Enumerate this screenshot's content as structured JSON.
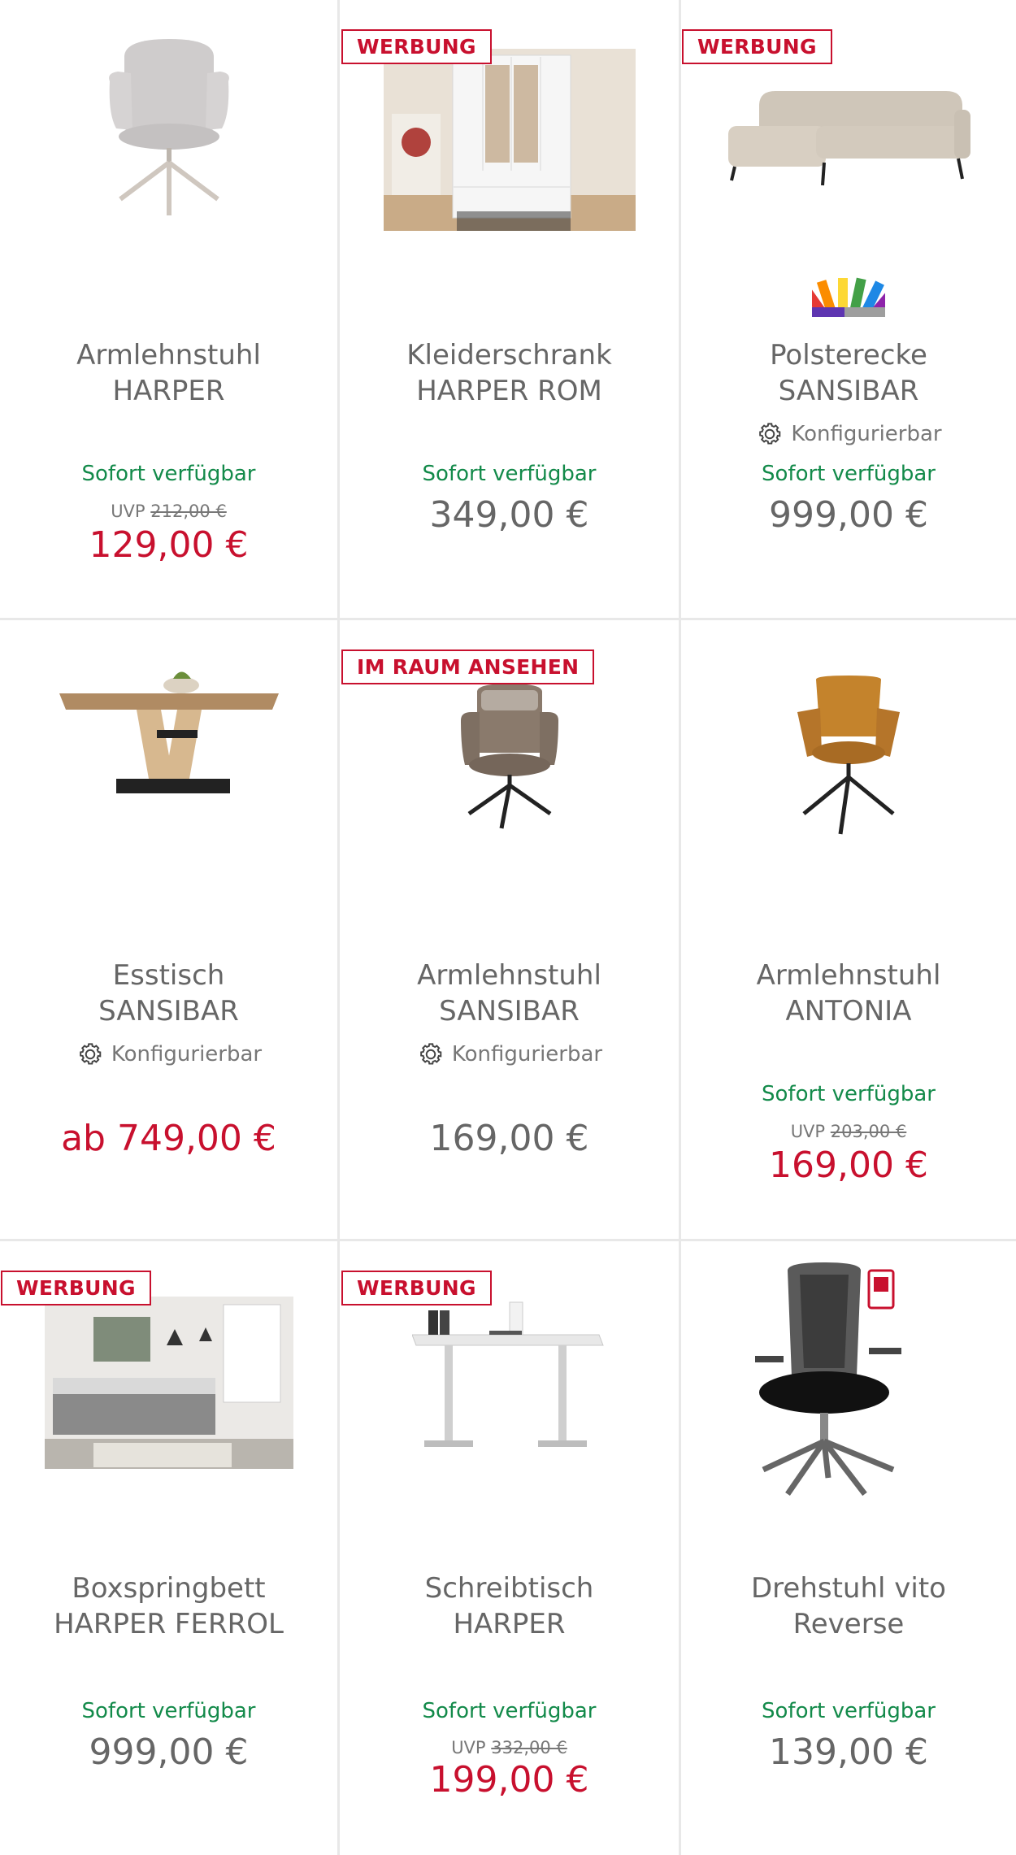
{
  "products": [
    {
      "badge": "",
      "title_line1": "Armlehnstuhl",
      "title_line2": "HARPER",
      "configurable": "",
      "availability": "Sofort verfügbar",
      "uvp_label": "UVP",
      "uvp_price": "212,00 €",
      "price": "129,00 €",
      "image": "chair-grey-armchair-icon"
    },
    {
      "badge": "WERBUNG",
      "title_line1": "Kleiderschrank",
      "title_line2": "HARPER ROM",
      "configurable": "",
      "availability": "Sofort verfügbar",
      "uvp_label": "",
      "uvp_price": "",
      "price": "349,00 €",
      "image": "wardrobe-icon"
    },
    {
      "badge": "WERBUNG",
      "title_line1": "Polsterecke",
      "title_line2": "SANSIBAR",
      "configurable": "Konfigurierbar",
      "availability": "Sofort verfügbar",
      "uvp_label": "",
      "uvp_price": "",
      "price": "999,00 €",
      "image": "sofa-icon"
    },
    {
      "badge": "",
      "title_line1": "Esstisch",
      "title_line2": "SANSIBAR",
      "configurable": "Konfigurierbar",
      "availability": "",
      "uvp_label": "",
      "uvp_price": "",
      "price": "ab 749,00 €",
      "image": "dining-table-icon"
    },
    {
      "badge": "IM RAUM ANSEHEN",
      "title_line1": "Armlehnstuhl",
      "title_line2": "SANSIBAR",
      "configurable": "Konfigurierbar",
      "availability": "",
      "uvp_label": "",
      "uvp_price": "",
      "price": "169,00 €",
      "image": "chair-brown-armchair-icon"
    },
    {
      "badge": "",
      "title_line1": "Armlehnstuhl",
      "title_line2": "ANTONIA",
      "configurable": "",
      "availability": "Sofort verfügbar",
      "uvp_label": "UVP",
      "uvp_price": "203,00 €",
      "price": "169,00 €",
      "image": "chair-orange-armchair-icon"
    },
    {
      "badge": "WERBUNG",
      "title_line1": "Boxspringbett",
      "title_line2": "HARPER FERROL",
      "configurable": "",
      "availability": "Sofort verfügbar",
      "uvp_label": "",
      "uvp_price": "",
      "price": "999,00 €",
      "image": "bed-room-icon"
    },
    {
      "badge": "WERBUNG",
      "title_line1": "Schreibtisch",
      "title_line2": "HARPER",
      "configurable": "",
      "availability": "Sofort verfügbar",
      "uvp_label": "UVP",
      "uvp_price": "332,00 €",
      "price": "199,00 €",
      "image": "desk-icon"
    },
    {
      "badge": "",
      "title_line1": "Drehstuhl vito",
      "title_line2": "Reverse",
      "configurable": "",
      "availability": "Sofort verfügbar",
      "uvp_label": "",
      "uvp_price": "",
      "price": "139,00 €",
      "image": "office-chair-icon"
    }
  ],
  "colors": {
    "sale": "#c8102e",
    "available": "#138a4a",
    "text": "#666666",
    "divider": "#e8e8e8"
  }
}
